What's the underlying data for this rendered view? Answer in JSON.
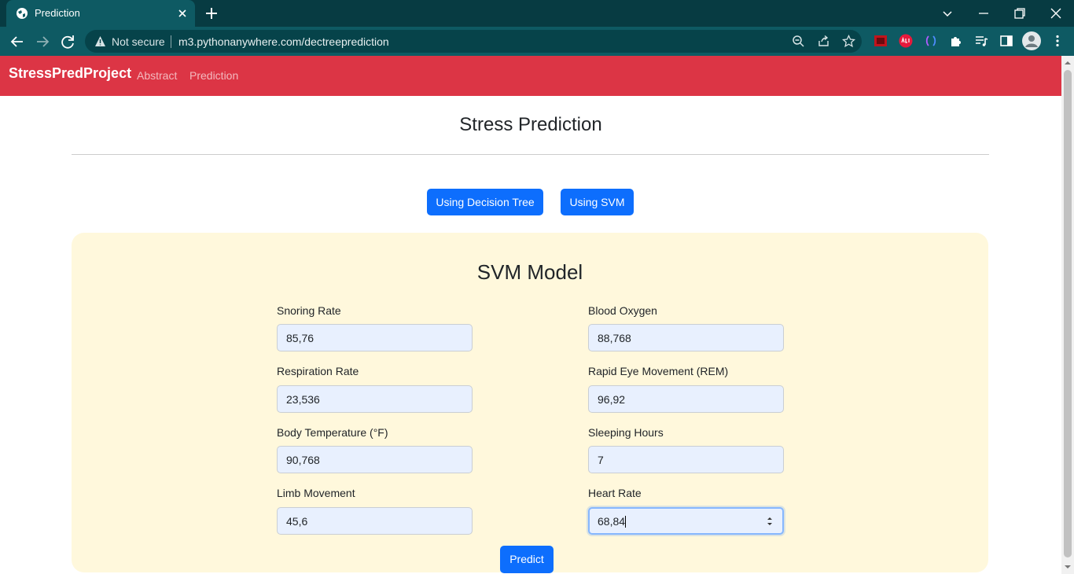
{
  "browser": {
    "tab_title": "Prediction",
    "security_label": "Not secure",
    "url": "m3.pythonanywhere.com/dectreeprediction"
  },
  "navbar": {
    "brand": "StressPredProject",
    "links": [
      "Abstract",
      "Prediction"
    ]
  },
  "page": {
    "title": "Stress Prediction",
    "buttons": [
      "Using Decision Tree",
      "Using SVM"
    ]
  },
  "form": {
    "title": "SVM Model",
    "fields": [
      {
        "label": "Snoring Rate",
        "value": "85,76"
      },
      {
        "label": "Blood Oxygen",
        "value": "88,768"
      },
      {
        "label": "Respiration Rate",
        "value": "23,536"
      },
      {
        "label": "Rapid Eye Movement (REM)",
        "value": "96,92"
      },
      {
        "label": "Body Temperature (°F)",
        "value": "90,768"
      },
      {
        "label": "Sleeping Hours",
        "value": "7"
      },
      {
        "label": "Limb Movement",
        "value": "45,6"
      },
      {
        "label": "Heart Rate",
        "value": "68,84"
      }
    ],
    "submit_label": "Predict"
  },
  "colors": {
    "navbar": "#dc3545",
    "primary": "#0d6efd",
    "card_background": "#fff8dc",
    "input_background": "#e8f0fe"
  }
}
